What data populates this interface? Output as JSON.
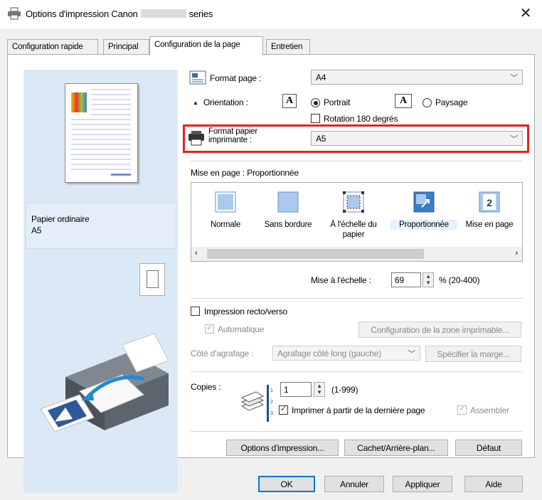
{
  "window": {
    "title_prefix": "Options d'impression Canon",
    "title_suffix": "series",
    "close_glyph": "✕"
  },
  "tabs": [
    {
      "label": "Configuration rapide"
    },
    {
      "label": "Principal"
    },
    {
      "label": "Configuration de la page"
    },
    {
      "label": "Entretien"
    }
  ],
  "preview": {
    "paper_type": "Papier ordinaire",
    "paper_size": "A5"
  },
  "page_setup": {
    "page_size_label": "Format page :",
    "page_size_value": "A4",
    "orientation_label": "Orientation :",
    "portrait_label": "Portrait",
    "landscape_label": "Paysage",
    "rotate_label": "Rotation 180 degrés",
    "printer_paper_label_1": "Format papier",
    "printer_paper_label_2": "imprimante :",
    "printer_paper_value": "A5",
    "layout_label": "Mise en page :",
    "layout_value": "Proportionnée",
    "layouts": [
      {
        "label": "Normale"
      },
      {
        "label": "Sans bordure"
      },
      {
        "label_1": "À l'échelle du",
        "label_2": "papier"
      },
      {
        "label": "Proportionnée"
      },
      {
        "label": "Mise en page"
      }
    ],
    "scale_label": "Mise à l'échelle :",
    "scale_value": "69",
    "scale_range": "% (20-400)"
  },
  "duplex": {
    "label": "Impression recto/verso",
    "auto_label": "Automatique",
    "print_area_button": "Configuration de la zone imprimable...",
    "stapling_label": "Côté d'agrafage :",
    "stapling_value": "Agrafage côté long (gauche)",
    "margin_button": "Spécifier la marge..."
  },
  "copies": {
    "label": "Copies :",
    "value": "1",
    "range": "(1-999)",
    "reverse_label": "Imprimer à partir de la dernière page",
    "collate_label": "Assembler"
  },
  "buttons": {
    "print_options": "Options d'impression...",
    "stamp_background": "Cachet/Arrière-plan...",
    "defaults": "Défaut",
    "ok": "OK",
    "cancel": "Annuler",
    "apply": "Appliquer",
    "help": "Aide"
  },
  "colors": {
    "highlight": "#e2231a",
    "preview_background": "#dbe9f6",
    "default_button_border": "#0078d7"
  }
}
